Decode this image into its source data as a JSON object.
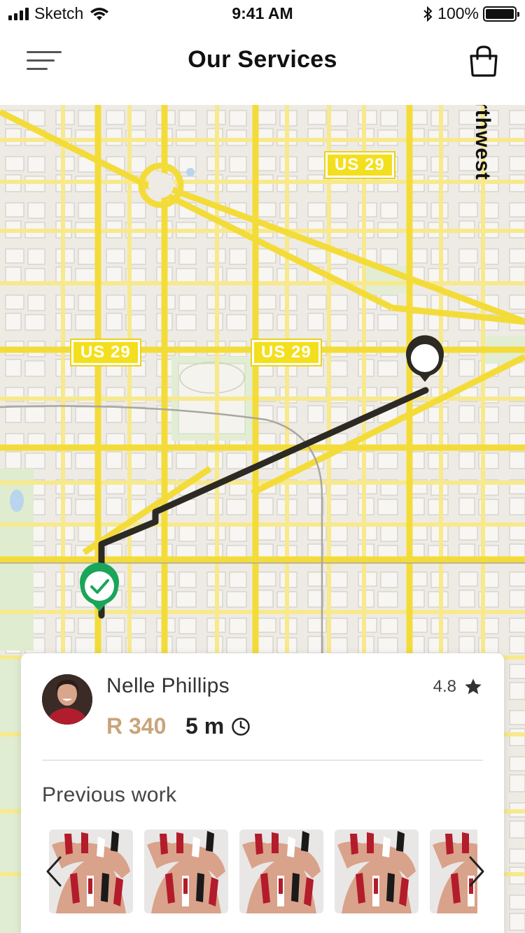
{
  "status_bar": {
    "carrier": "Sketch",
    "time": "9:41 AM",
    "battery": "100%"
  },
  "header": {
    "title": "Our Services",
    "menu_icon": "menu-icon",
    "cart_icon": "shopping-bag-icon"
  },
  "map": {
    "route_shields": [
      "US 29",
      "US 29",
      "US 29"
    ],
    "street_label": "rthwest",
    "destination_pin": "destination-pin-icon",
    "origin_pin": "check-pin-icon",
    "colors": {
      "route": "#2c2a22",
      "road": "#f7e36a",
      "origin_pin": "#1aa55a"
    }
  },
  "provider": {
    "name": "Nelle Phillips",
    "rating": "4.8",
    "price": "R 340",
    "duration": "5 m"
  },
  "previous_work": {
    "title": "Previous work",
    "items": [
      "nail-photo",
      "nail-photo",
      "nail-photo",
      "nail-photo",
      "nail-photo"
    ]
  },
  "colors": {
    "accent_price": "#c9a47a"
  }
}
